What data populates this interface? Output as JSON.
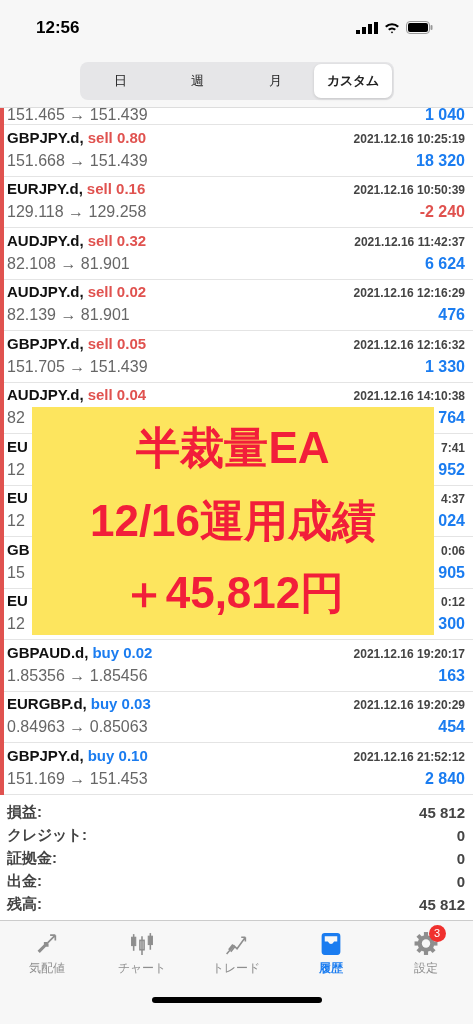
{
  "status_bar": {
    "time": "12:56"
  },
  "period_tabs": [
    {
      "label": "日",
      "selected": false
    },
    {
      "label": "週",
      "selected": false
    },
    {
      "label": "月",
      "selected": false
    },
    {
      "label": "カスタム",
      "selected": true
    }
  ],
  "deals": [
    {
      "kind": "prices_only",
      "prices": "151.465 → 151.439",
      "profit": "1 040",
      "loss": false
    },
    {
      "kind": "full",
      "symbol": "GBPJPY.d,",
      "order": "sell 0.80",
      "color": "#e0524f",
      "time": "2021.12.16 10:25:19",
      "prices": "151.668 → 151.439",
      "profit": "18 320",
      "loss": false
    },
    {
      "kind": "full",
      "symbol": "EURJPY.d,",
      "order": "sell 0.16",
      "color": "#e0524f",
      "time": "2021.12.16 10:50:39",
      "prices": "129.118 → 129.258",
      "profit": "-2 240",
      "loss": true
    },
    {
      "kind": "full",
      "symbol": "AUDJPY.d,",
      "order": "sell 0.32",
      "color": "#e0524f",
      "time": "2021.12.16 11:42:37",
      "prices": "82.108 → 81.901",
      "profit": "6 624",
      "loss": false
    },
    {
      "kind": "full",
      "symbol": "AUDJPY.d,",
      "order": "sell 0.02",
      "color": "#e0524f",
      "time": "2021.12.16 12:16:29",
      "prices": "82.139 → 81.901",
      "profit": "476",
      "loss": false
    },
    {
      "kind": "full",
      "symbol": "GBPJPY.d,",
      "order": "sell 0.05",
      "color": "#e0524f",
      "time": "2021.12.16 12:16:32",
      "prices": "151.705 → 151.439",
      "profit": "1 330",
      "loss": false
    },
    {
      "kind": "full",
      "symbol": "AUDJPY.d,",
      "order": "sell 0.04",
      "color": "#e0524f",
      "time": "2021.12.16 14:10:38",
      "prices": "82",
      "profit": "764",
      "loss": false
    },
    {
      "kind": "fragment",
      "symbol": "EU",
      "time": "7:41",
      "prices": "12",
      "profit": "952",
      "loss": false
    },
    {
      "kind": "fragment",
      "symbol": "EU",
      "time": "4:37",
      "prices": "12",
      "profit": "024",
      "loss": false
    },
    {
      "kind": "fragment",
      "symbol": "GB",
      "time": "0:06",
      "prices": "15",
      "profit": "905",
      "loss": false
    },
    {
      "kind": "fragment",
      "symbol": "EU",
      "time": "0:12",
      "prices": "12",
      "profit": "300",
      "loss": false
    },
    {
      "kind": "full",
      "symbol": "GBPAUD.d,",
      "order": "buy 0.02",
      "color": "#1a7cf0",
      "time": "2021.12.16 19:20:17",
      "prices": "1.85356 → 1.85456",
      "profit": "163",
      "loss": false
    },
    {
      "kind": "full",
      "symbol": "EURGBP.d,",
      "order": "buy 0.03",
      "color": "#1a7cf0",
      "time": "2021.12.16 19:20:29",
      "prices": "0.84963 → 0.85063",
      "profit": "454",
      "loss": false
    },
    {
      "kind": "full",
      "symbol": "GBPJPY.d,",
      "order": "buy 0.10",
      "color": "#1a7cf0",
      "time": "2021.12.16 21:52:12",
      "prices": "151.169 → 151.453",
      "profit": "2 840",
      "loss": false
    }
  ],
  "overlay_banner": {
    "lines": [
      "半裁量EA",
      "12/16運用成績",
      "＋45,812円"
    ]
  },
  "summary": [
    {
      "label": "損益:",
      "value": "45 812"
    },
    {
      "label": "クレジット:",
      "value": "0"
    },
    {
      "label": "証拠金:",
      "value": "0"
    },
    {
      "label": "出金:",
      "value": "0"
    },
    {
      "label": "残高:",
      "value": "45 812"
    }
  ],
  "tab_bar": [
    {
      "kind": "quotes",
      "label": "気配値",
      "selected": false
    },
    {
      "kind": "chart",
      "label": "チャート",
      "selected": false
    },
    {
      "kind": "trade",
      "label": "トレード",
      "selected": false
    },
    {
      "kind": "history",
      "label": "履歴",
      "selected": true
    },
    {
      "kind": "settings",
      "label": "設定",
      "selected": false,
      "badge": "3"
    }
  ]
}
